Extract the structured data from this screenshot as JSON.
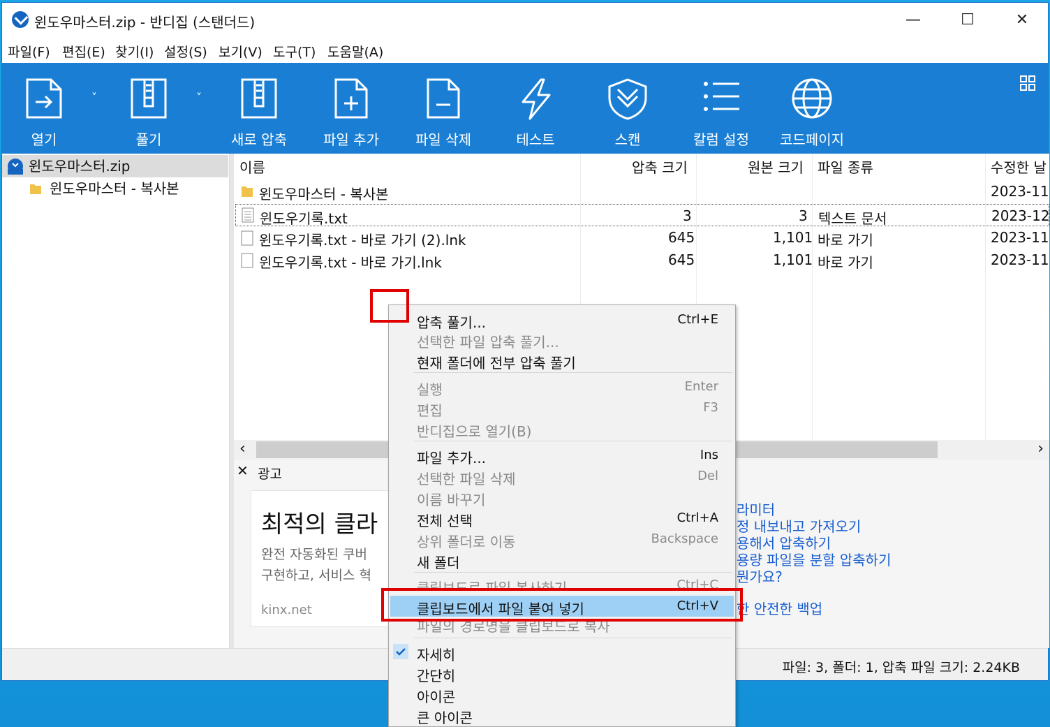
{
  "window": {
    "title": "윈도우마스터.zip - 반디집 (스탠더드)",
    "min_icon": "minimize-icon",
    "max_icon": "maximize-icon",
    "close_icon": "close-icon",
    "min_glyph": "—",
    "max_glyph": "☐",
    "close_glyph": "✕"
  },
  "menu": [
    "파일(F)",
    "편집(E)",
    "찾기(I)",
    "설정(S)",
    "보기(V)",
    "도구(T)",
    "도움말(A)"
  ],
  "toolbar": {
    "open": "열기",
    "extract": "풀기",
    "new_archive": "새로 압축",
    "add_file": "파일 추가",
    "delete_file": "파일 삭제",
    "test": "테스트",
    "scan": "스캔",
    "columns": "칼럼 설정",
    "codepage": "코드페이지",
    "dropdown_glyph": "˅"
  },
  "tree": {
    "root": "윈도우마스터.zip",
    "child": "윈도우마스터 - 복사본"
  },
  "columns": {
    "name": "이름",
    "packed": "압축 크기",
    "original": "원본 크기",
    "type": "파일 종류",
    "modified": "수정한 날"
  },
  "files": [
    {
      "name": "윈도우마스터 - 복사본",
      "packed": "",
      "original": "",
      "type": "",
      "modified": "2023-11-",
      "icon": "folder-icon"
    },
    {
      "name": "윈도우기록.txt",
      "packed": "3",
      "original": "3",
      "type": "텍스트 문서",
      "modified": "2023-12-",
      "icon": "text-file-icon"
    },
    {
      "name": "윈도우기록.txt - 바로 가기 (2).lnk",
      "packed": "645",
      "original": "1,101",
      "type": "바로 가기",
      "modified": "2023-11-",
      "icon": "file-icon"
    },
    {
      "name": "윈도우기록.txt - 바로 가기.lnk",
      "packed": "645",
      "original": "1,101",
      "type": "바로 가기",
      "modified": "2023-11-",
      "icon": "file-icon"
    }
  ],
  "scroll": {
    "left": "‹",
    "right": "›"
  },
  "ad": {
    "close_glyph": "✕",
    "label": "광고",
    "headline": "최적의 클라",
    "body1": "완전 자동화된 쿠버",
    "body2": "구현하고, 서비스 혁",
    "domain": "kinx.net",
    "links": [
      "라미터",
      "정 내보내고 가져오기",
      "용해서 압축하기",
      "용량 파일을 분할 압축하기",
      "뭔가요?",
      "한 안전한 백업"
    ]
  },
  "status": {
    "text": "파일: 3, 폴더: 1, 압축 파일 크기: 2.24KB"
  },
  "context_menu": {
    "items": [
      {
        "label": "압축 풀기...",
        "shortcut": "Ctrl+E",
        "disabled": false
      },
      {
        "label": "선택한 파일 압축 풀기...",
        "shortcut": "",
        "disabled": true
      },
      {
        "label": "현재 폴더에 전부 압축 풀기",
        "shortcut": "",
        "disabled": false
      },
      {
        "label": "실행",
        "shortcut": "Enter",
        "disabled": true
      },
      {
        "label": "편집",
        "shortcut": "F3",
        "disabled": true
      },
      {
        "label": "반디집으로 열기(B)",
        "shortcut": "",
        "disabled": true
      },
      {
        "label": "파일 추가...",
        "shortcut": "Ins",
        "disabled": false
      },
      {
        "label": "선택한 파일 삭제",
        "shortcut": "Del",
        "disabled": true
      },
      {
        "label": "이름 바꾸기",
        "shortcut": "",
        "disabled": true
      },
      {
        "label": "전체 선택",
        "shortcut": "Ctrl+A",
        "disabled": false
      },
      {
        "label": "상위 폴더로 이동",
        "shortcut": "Backspace",
        "disabled": true
      },
      {
        "label": "새 폴더",
        "shortcut": "",
        "disabled": false
      },
      {
        "label": "클립보드로 파일 복사하기",
        "shortcut": "Ctrl+C",
        "disabled": true
      },
      {
        "label": "클립보드에서 파일 붙여 넣기",
        "shortcut": "Ctrl+V",
        "disabled": false,
        "highlighted": true
      },
      {
        "label": "파일의 경로명을 클립보드로 복사",
        "shortcut": "",
        "disabled": true
      },
      {
        "label": "자세히",
        "shortcut": "",
        "disabled": false,
        "checked": true
      },
      {
        "label": "간단히",
        "shortcut": "",
        "disabled": false
      },
      {
        "label": "아이콘",
        "shortcut": "",
        "disabled": false
      },
      {
        "label": "큰 아이콘",
        "shortcut": "",
        "disabled": false
      }
    ]
  },
  "colors": {
    "toolbar": "#1a7fd4",
    "highlight": "#9ed0f5",
    "annotation": "#e00000",
    "link": "#1a5fd0"
  }
}
